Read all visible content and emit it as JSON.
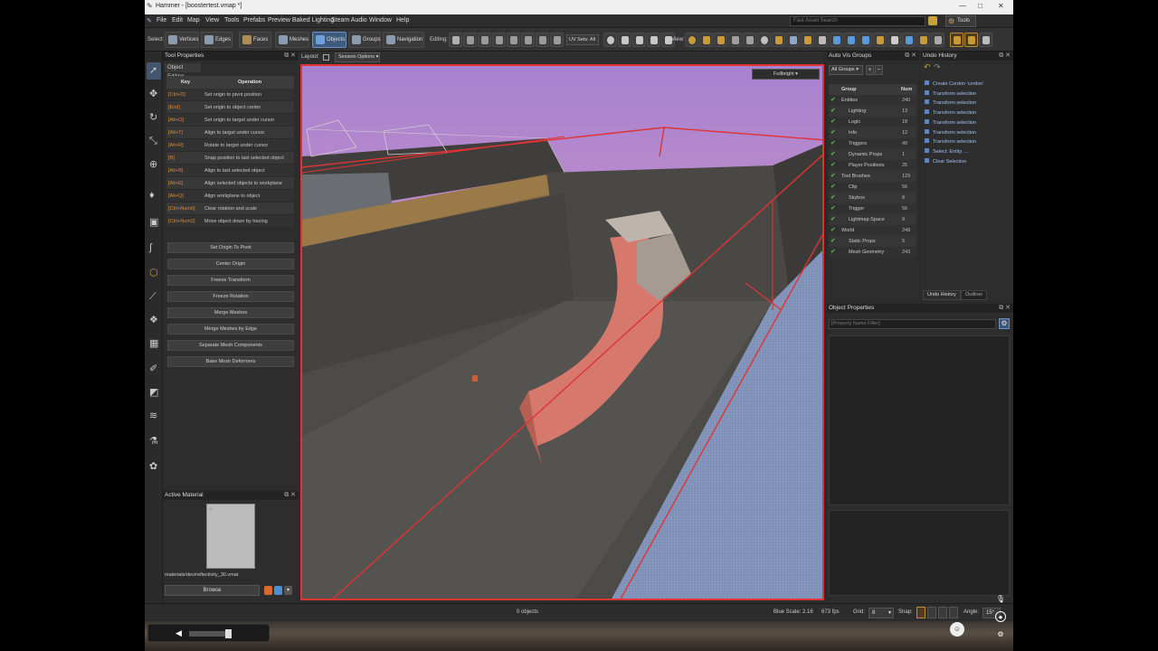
{
  "window": {
    "title": "Hammer - [boostertest.vmap *]"
  },
  "menu": [
    "File",
    "Edit",
    "Map",
    "View",
    "Tools",
    "Prefabs",
    "Preview Baked Lighting",
    "Steam Audio",
    "Window",
    "Help"
  ],
  "search": {
    "placeholder": "Fast Asset Search"
  },
  "tools_button": "Tools",
  "toolbar": {
    "select_label": "Select:",
    "modes": [
      "Vertices",
      "Edges",
      "Faces",
      "Meshes",
      "Objects",
      "Groups",
      "Navigation"
    ],
    "active_mode": "Objects",
    "editing_label": "Editing:",
    "uv_sets": "UV Sets: All",
    "view_label": "View:"
  },
  "tool_properties": {
    "title": "Tool Properties",
    "section": "Object Editing",
    "key_header": "Key",
    "op_header": "Operation",
    "rows": [
      {
        "key": "[Ctrl+D]",
        "op": "Set origin to pivot position"
      },
      {
        "key": "[End]",
        "op": "Set origin to object center"
      },
      {
        "key": "[Alt+O]",
        "op": "Set origin to target under cursor"
      },
      {
        "key": "[Alt+T]",
        "op": "Align to target under cursor"
      },
      {
        "key": "[Alt+R]",
        "op": "Rotate to target under cursor"
      },
      {
        "key": "[B]",
        "op": "Snap position to last selected object"
      },
      {
        "key": "[Alt+B]",
        "op": "Align to last selected object"
      },
      {
        "key": "[Alt+E]",
        "op": "Align selected objects to workplane"
      },
      {
        "key": "[Alt+Q]",
        "op": "Align workplane to object"
      },
      {
        "key": "[Ctrl+Num0]",
        "op": "Clear rotation and scale"
      },
      {
        "key": "[Ctrl+Num2]",
        "op": "Move object down by tracing"
      }
    ],
    "buttons": [
      "Set Origin To Pivot",
      "Center Origin",
      "Freeze Transform",
      "Freeze Rotation",
      "Merge Meshes",
      "Merge Meshes by Edge",
      "Separate Mesh Components",
      "Bake Mesh Deformers"
    ]
  },
  "active_material": {
    "title": "Active Material",
    "path": "materials/dev/reflectivity_30.vmat",
    "browse": "Browse"
  },
  "viewport": {
    "layout_label": "Layout:",
    "session_options": "Session Options",
    "render_mode": "Fullbright"
  },
  "auto_vis_groups": {
    "title": "Auto Vis Groups",
    "filter": "All Groups",
    "group_header": "Group",
    "num_header": "Num",
    "groups": [
      {
        "name": "Entities",
        "num": "240",
        "level": 0
      },
      {
        "name": "Lighting",
        "num": "13",
        "level": 1
      },
      {
        "name": "Logic",
        "num": "18",
        "level": 1
      },
      {
        "name": "Info",
        "num": "12",
        "level": 1
      },
      {
        "name": "Triggers",
        "num": "49",
        "level": 1
      },
      {
        "name": "Dynamic Props",
        "num": "1",
        "level": 1
      },
      {
        "name": "Player Positions",
        "num": "25",
        "level": 1
      },
      {
        "name": "Tool Brushes",
        "num": "129",
        "level": 0
      },
      {
        "name": "Clip",
        "num": "56",
        "level": 1
      },
      {
        "name": "Skybox",
        "num": "8",
        "level": 1
      },
      {
        "name": "Trigger",
        "num": "56",
        "level": 1
      },
      {
        "name": "Lightmap Space",
        "num": "9",
        "level": 1
      },
      {
        "name": "World",
        "num": "248",
        "level": 0
      },
      {
        "name": "Static Props",
        "num": "5",
        "level": 1
      },
      {
        "name": "Mesh Geometry",
        "num": "243",
        "level": 1
      }
    ]
  },
  "undo_history": {
    "title": "Undo History",
    "items": [
      "Create Cordon 'cordon'",
      "Transform selection",
      "Transform selection",
      "Transform selection",
      "Transform selection",
      "Transform selection",
      "Transform selection",
      "Select: Entity: ...",
      "Clear Selection"
    ],
    "tabs": [
      "Undo History",
      "Outliner"
    ]
  },
  "object_properties": {
    "title": "Object Properties",
    "filter_placeholder": "[Property Name Filter]"
  },
  "status": {
    "selection": "0 objects",
    "blue_scale": "Blue Scale: 2.16",
    "fps": "673 fps",
    "grid_label": "Grid:",
    "grid_value": "8",
    "snap_label": "Snap:",
    "angle_label": "Angle:",
    "angle_value": "15°"
  },
  "colors": {
    "accent": "#3e5a7d",
    "cordon_red": "#e03333",
    "key_orange": "#d98b3a",
    "check_green": "#4ec05a"
  }
}
